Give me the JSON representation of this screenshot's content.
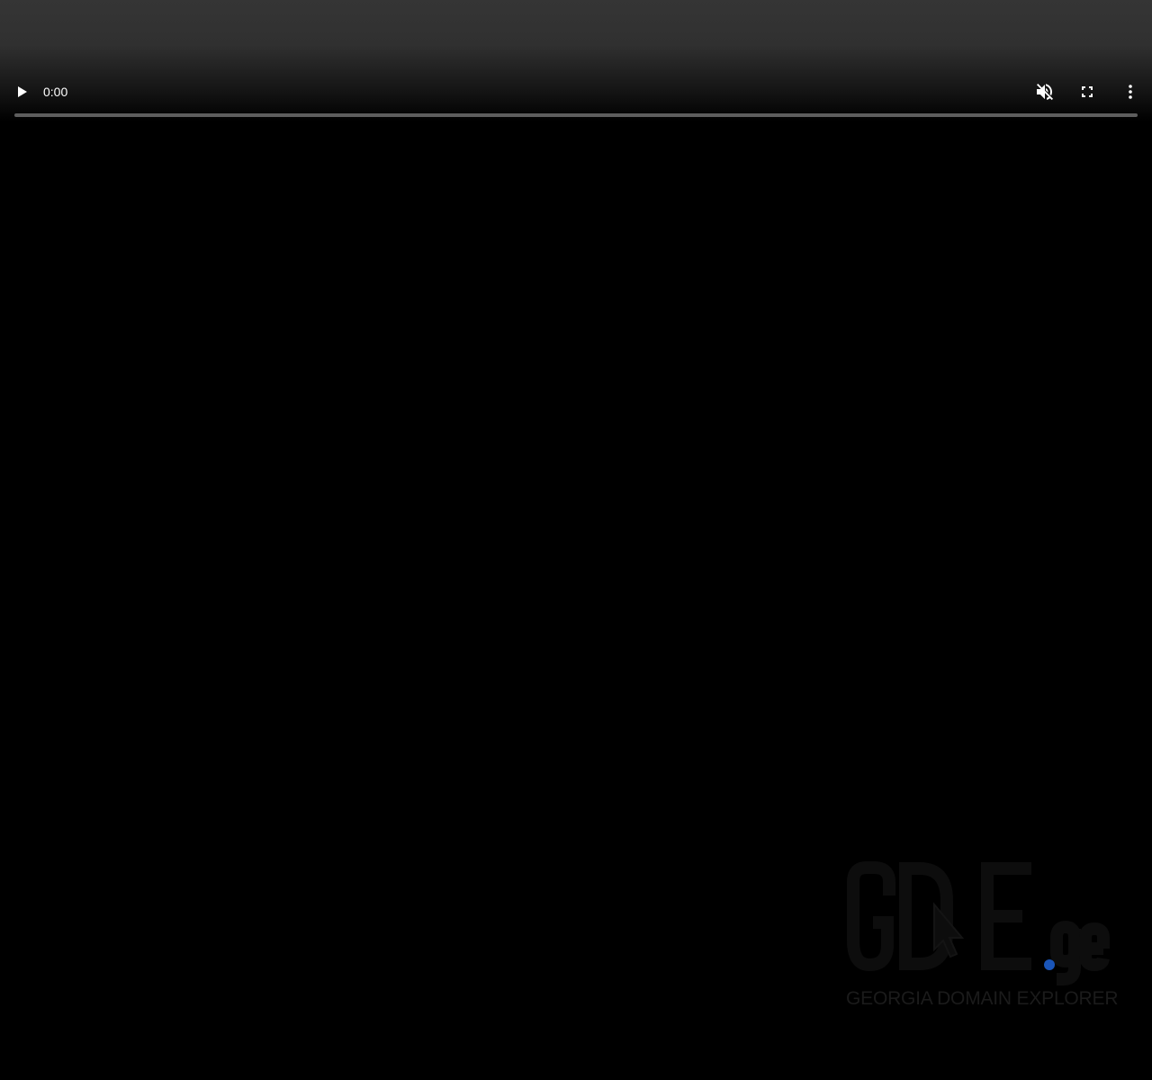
{
  "player": {
    "current_time": "0:00",
    "progress": 0,
    "muted": true
  },
  "icons": {
    "play": "play-icon",
    "mute": "volume-muted-icon",
    "fullscreen": "fullscreen-icon",
    "more": "more-vertical-icon"
  },
  "watermark": {
    "logo_text": "GDE.ge",
    "subtitle": "GEORGIA DOMAIN EXPLORER"
  },
  "colors": {
    "background": "#000000",
    "logo_dot": "#1a55b8",
    "logo_letters": "#0d0d0d",
    "timeline_track": "#5e5e5e"
  }
}
